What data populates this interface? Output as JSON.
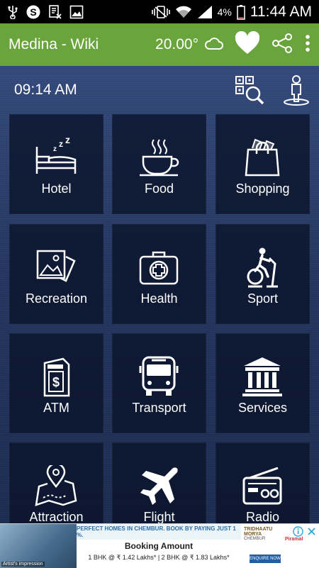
{
  "status_bar": {
    "battery_percent": "4%",
    "time": "11:44 AM"
  },
  "app_bar": {
    "title": "Medina - Wiki",
    "temperature": "20.00°",
    "icons": [
      "cloud-icon",
      "heart-icon",
      "share-icon",
      "more-vert-icon"
    ]
  },
  "header": {
    "clock": "09:14 AM",
    "icons": [
      "qr-search-icon",
      "person-icon"
    ]
  },
  "tiles": [
    {
      "label": "Hotel",
      "icon": "bed-icon"
    },
    {
      "label": "Food",
      "icon": "coffee-cup-icon"
    },
    {
      "label": "Shopping",
      "icon": "shopping-bag-icon"
    },
    {
      "label": "Recreation",
      "icon": "photos-icon"
    },
    {
      "label": "Health",
      "icon": "medical-kit-icon"
    },
    {
      "label": "Sport",
      "icon": "exercise-bike-icon"
    },
    {
      "label": "ATM",
      "icon": "atm-icon"
    },
    {
      "label": "Transport",
      "icon": "bus-icon"
    },
    {
      "label": "Services",
      "icon": "bank-building-icon"
    },
    {
      "label": "Attraction",
      "icon": "map-pin-icon"
    },
    {
      "label": "Flight",
      "icon": "airplane-icon"
    },
    {
      "label": "Radio",
      "icon": "radio-icon"
    }
  ],
  "ad": {
    "image_caption": "Artist's impression",
    "headline": "PERFECT HOMES IN CHEMBUR. BOOK BY PAYING JUST 1 %.",
    "booking_label": "Booking Amount",
    "prices": "1 BHK @ ₹ 1.42 Lakhs* | 2 BHK @ ₹ 1.83 Lakhs*",
    "brand": "TRIDHAATU MORYA",
    "brand_sub": "CHEMBUR",
    "cta": "ENQUIRE NOW",
    "partner": "Piramal"
  },
  "colors": {
    "app_bar": "#6aa43d",
    "status_bar": "#000000",
    "tile_bg": "#0a1430",
    "background": "#23355f"
  }
}
